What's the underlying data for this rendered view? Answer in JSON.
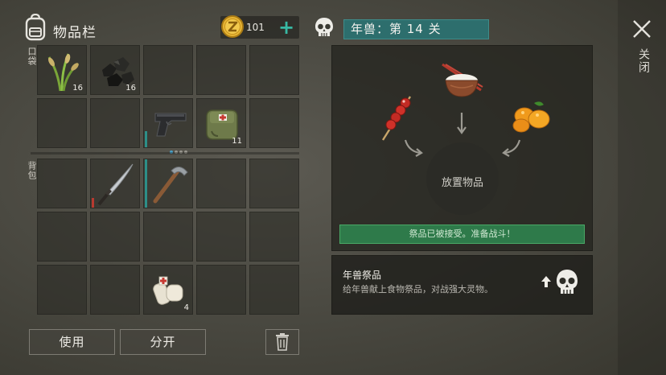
{
  "header": {
    "title": "物品栏",
    "coins": "101",
    "add_symbol": "+",
    "level_banner": "年兽：第 14 关",
    "close_label": "关闭"
  },
  "sections": {
    "pocket_label": "口袋",
    "backpack_label": "背包"
  },
  "pocket_slots": [
    {
      "item": "wheat-icon",
      "count": "16"
    },
    {
      "item": "coal-icon",
      "count": "16"
    },
    {
      "item": "",
      "count": ""
    },
    {
      "item": "",
      "count": ""
    },
    {
      "item": "",
      "count": ""
    },
    {
      "item": "",
      "count": ""
    },
    {
      "item": "",
      "count": ""
    },
    {
      "item": "pistol-icon",
      "count": ""
    },
    {
      "item": "medkit-bag-icon",
      "count": "11"
    },
    {
      "item": "",
      "count": ""
    }
  ],
  "backpack_slots": [
    {
      "item": "",
      "count": ""
    },
    {
      "item": "katana-icon",
      "count": ""
    },
    {
      "item": "pickaxe-icon",
      "count": ""
    },
    {
      "item": "",
      "count": ""
    },
    {
      "item": "",
      "count": ""
    },
    {
      "item": "",
      "count": ""
    },
    {
      "item": "",
      "count": ""
    },
    {
      "item": "",
      "count": ""
    },
    {
      "item": "",
      "count": ""
    },
    {
      "item": "",
      "count": ""
    },
    {
      "item": "",
      "count": ""
    },
    {
      "item": "",
      "count": ""
    },
    {
      "item": "bandage-icon",
      "count": "4"
    },
    {
      "item": "",
      "count": ""
    },
    {
      "item": "",
      "count": ""
    }
  ],
  "buttons": {
    "use": "使用",
    "split": "分开"
  },
  "altar": {
    "drop_label": "放置物品",
    "status": "祭品已被接受。准备战斗！",
    "offerings": [
      "candied-haws-icon",
      "rice-bowl-icon",
      "kumquat-icon"
    ]
  },
  "info": {
    "title": "年兽祭品",
    "description": "给年兽献上食物祭品，对战强大灵物。"
  },
  "colors": {
    "banner": "#2d6e6d",
    "accent": "#38b9a4",
    "status_green": "#2e7a4a"
  }
}
